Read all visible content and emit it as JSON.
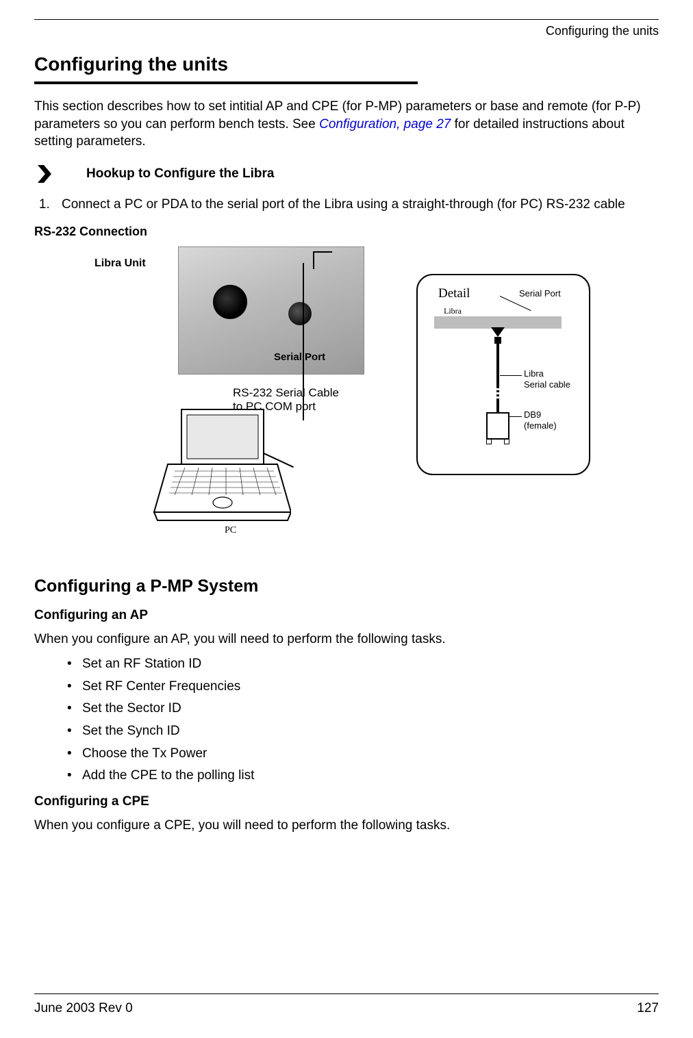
{
  "header_label": "Configuring the units",
  "title": "Configuring the units",
  "intro_before_link": "This section describes how to set intitial AP and CPE (for P-MP) parameters or base and remote (for P-P) parameters so you can perform bench tests. See ",
  "intro_link": "Configuration, page 27",
  "intro_after_link": " for detailed instructions about setting parameters.",
  "procedure_title": "Hookup to Configure the Libra",
  "step_1": "Connect a PC or PDA to the serial port of the Libra using a straight-through (for PC) RS-232 cable",
  "fig_caption": "RS-232 Connection",
  "fig": {
    "libra_unit": "Libra Unit",
    "serial_port": "Serial Port",
    "cable_line_1": "RS-232 Serial Cable",
    "cable_line_2": "to PC COM port",
    "pc": "PC",
    "detail_title": "Detail",
    "detail_serial_port": "Serial Port",
    "detail_libra": "Libra",
    "detail_serial_cable": "Libra\nSerial cable",
    "detail_serial_cable_1": "Libra",
    "detail_serial_cable_2": "Serial cable",
    "detail_db9_1": "DB9",
    "detail_db9_2": "(female)"
  },
  "subsection_title": "Configuring a P-MP System",
  "ap_heading": "Configuring an AP",
  "ap_intro": "When you configure an AP, you will need to perform the following tasks.",
  "ap_tasks": [
    "Set an RF Station ID",
    "Set RF Center Frequencies",
    "Set the Sector ID",
    "Set the Synch ID",
    "Choose the Tx Power",
    "Add the CPE to the polling list"
  ],
  "cpe_heading": "Configuring a CPE",
  "cpe_intro": "When you configure a CPE, you will need to perform the following tasks.",
  "footer_left": "June 2003 Rev 0",
  "footer_right": "127"
}
